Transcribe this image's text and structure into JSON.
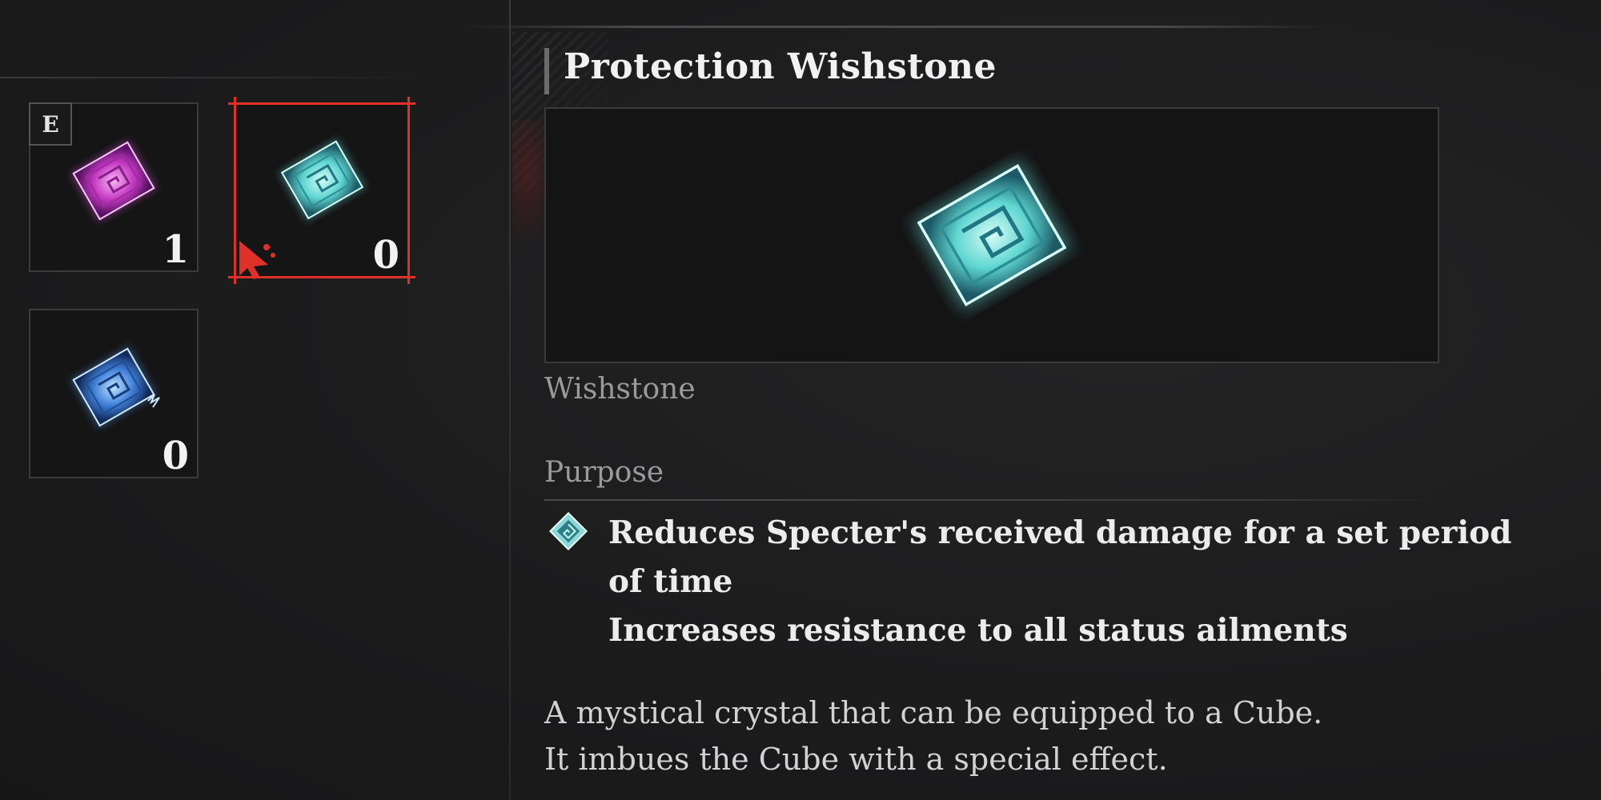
{
  "inventory": {
    "slots": [
      {
        "count": "1",
        "equipped_badge": "E",
        "gem": "pink-wishstone-icon",
        "color": "#d84bd6"
      },
      {
        "count": "0",
        "gem": "protection-wishstone-icon",
        "color": "#5fd6d0",
        "selected": true
      },
      {
        "count": "0",
        "gem": "blue-wishstone-icon",
        "color": "#4a90e6"
      }
    ],
    "selection_color": "#e0302a"
  },
  "detail": {
    "title": "Protection Wishstone",
    "type": "Wishstone",
    "purpose_heading": "Purpose",
    "effects": [
      "Reduces Specter's received damage for a set period",
      "of time",
      "Increases resistance to all status ailments"
    ],
    "description": [
      "A mystical crystal that can be equipped to a Cube.",
      "It imbues the Cube with a special effect."
    ]
  }
}
